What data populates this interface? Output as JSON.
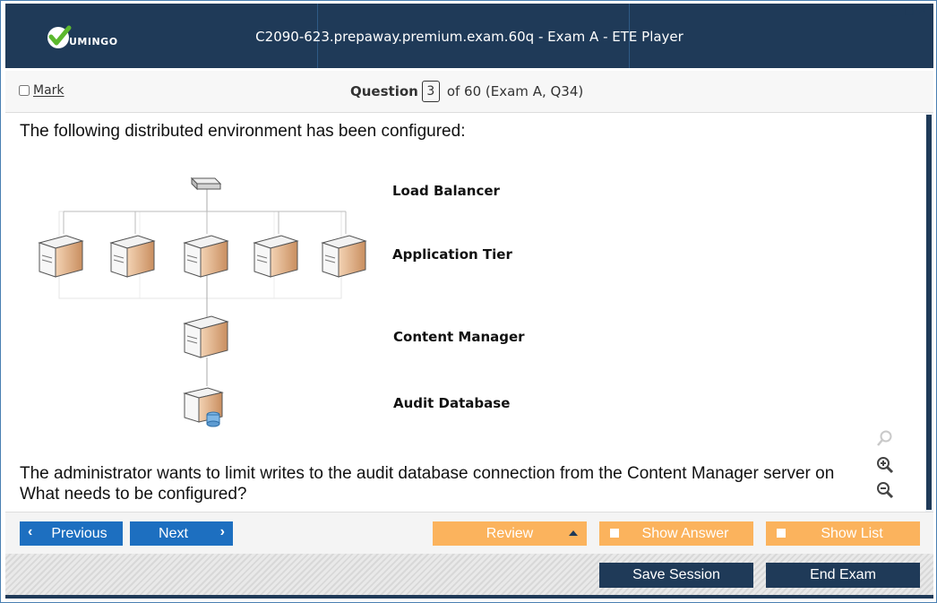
{
  "window": {
    "title": "C2090-623.prepaway.premium.exam.60q - Exam A - ETE Player",
    "logo_text": "UMINGO",
    "controls": {
      "minimize": "_",
      "maximize": "□",
      "close": "✕"
    }
  },
  "question_bar": {
    "mark_label": "Mark",
    "question_label": "Question",
    "question_number": "3",
    "question_suffix": "of 60 (Exam A, Q34)"
  },
  "content": {
    "intro": "The following distributed environment has been configured:",
    "diagram_labels": {
      "load_balancer": "Load Balancer",
      "application_tier": "Application Tier",
      "content_manager": "Content Manager",
      "audit_database": "Audit Database"
    },
    "question_line1": "The administrator wants to limit writes to the audit database connection from the Content Manager server on",
    "question_line2": "What needs to be configured?"
  },
  "nav": {
    "previous": "Previous",
    "next": "Next",
    "review": "Review",
    "show_answer": "Show Answer",
    "show_list": "Show List"
  },
  "footer": {
    "save_session": "Save Session",
    "end_exam": "End Exam"
  },
  "colors": {
    "title_bg": "#1f3a58",
    "nav_blue": "#1d6fc0",
    "nav_orange": "#fbb35d",
    "logo_check": "#5cb82e"
  }
}
